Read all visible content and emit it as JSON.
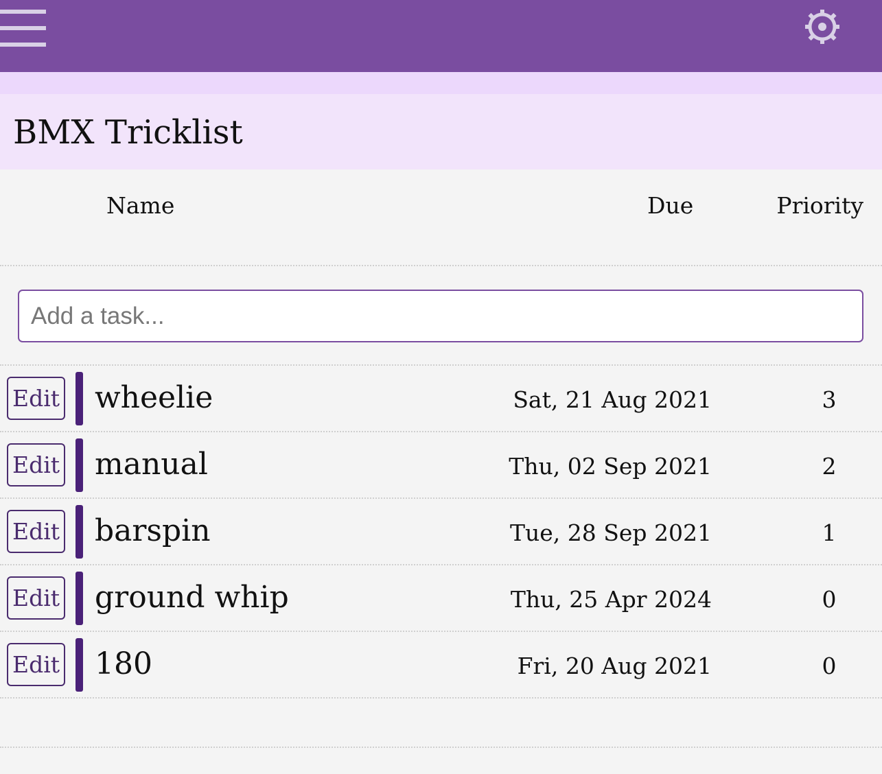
{
  "header": {
    "menu_icon": "hamburger-menu-icon",
    "settings_icon": "gear-icon",
    "colors": {
      "topbar": "#7a4da0",
      "band": "#ecd8fc",
      "title_bar": "#f2e4fb",
      "accent": "#4a2178"
    }
  },
  "page": {
    "title": "BMX Tricklist"
  },
  "columns": {
    "name": "Name",
    "due": "Due",
    "priority": "Priority"
  },
  "add_task": {
    "placeholder": "Add a task...",
    "value": ""
  },
  "tasks": [
    {
      "edit_label": "Edit",
      "name": "wheelie",
      "due": "Sat, 21 Aug 2021",
      "priority": "3"
    },
    {
      "edit_label": "Edit",
      "name": "manual",
      "due": "Thu, 02 Sep 2021",
      "priority": "2"
    },
    {
      "edit_label": "Edit",
      "name": "barspin",
      "due": "Tue, 28 Sep 2021",
      "priority": "1"
    },
    {
      "edit_label": "Edit",
      "name": "ground whip",
      "due": "Thu, 25 Apr 2024",
      "priority": "0"
    },
    {
      "edit_label": "Edit",
      "name": "180",
      "due": "Fri, 20 Aug 2021",
      "priority": "0"
    }
  ]
}
